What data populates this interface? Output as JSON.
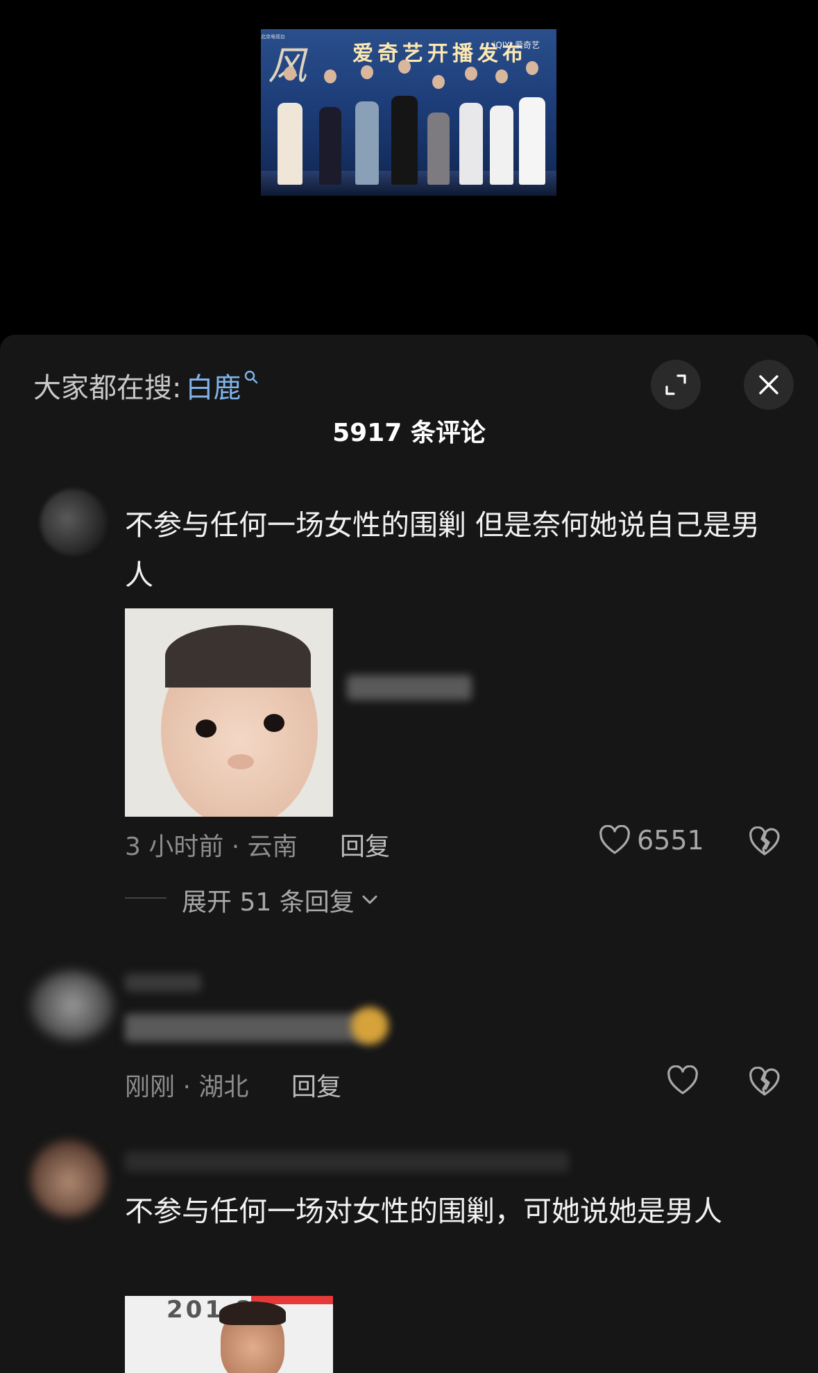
{
  "video": {
    "banner_title": "爱奇艺开播发布",
    "banner_calligraphy": "风",
    "banner_small": "北京电视台",
    "banner_watermark": "iQIYI 爱奇艺"
  },
  "sheet": {
    "search_prefix": "大家都在搜:",
    "search_keyword": "白鹿",
    "comment_count": "5917 条评论"
  },
  "comments": [
    {
      "text": "不参与任何一场女性的围剿 但是奈何她说自己是男人",
      "time_location": "3 小时前 · 云南",
      "reply_label": "回复",
      "likes": "6551",
      "expand_label": "展开 51 条回复"
    },
    {
      "text": "",
      "time_location": "刚刚 · 湖北",
      "reply_label": "回复",
      "likes": ""
    },
    {
      "text": "不参与任何一场对女性的围剿，可她说她是男人",
      "image_caption": "201 8"
    }
  ],
  "colors": {
    "sheet_bg": "#161616",
    "keyword": "#7fb3ea",
    "muted": "#8d8d8d"
  }
}
